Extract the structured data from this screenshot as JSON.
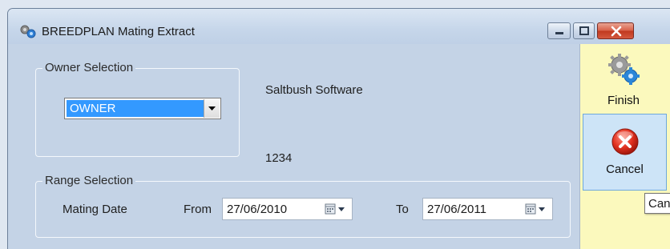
{
  "window": {
    "title": "BREEDPLAN Mating Extract",
    "icon": "gears-icon"
  },
  "owner_selection": {
    "legend": "Owner Selection",
    "owner_dropdown": {
      "selected": "OWNER"
    }
  },
  "info": {
    "company": "Saltbush Software",
    "code": "1234"
  },
  "range_selection": {
    "legend": "Range Selection",
    "row_label": "Mating Date",
    "from_label": "From",
    "from_date": "27/06/2010",
    "to_label": "To",
    "to_date": "27/06/2011"
  },
  "side_panel": {
    "finish_label": "Finish",
    "cancel_label": "Cancel",
    "background": "#fbf9bd"
  },
  "tooltip": {
    "text": "Cancel"
  },
  "colors": {
    "selection": "#3399ff",
    "window_bg": "#c4d3e6",
    "close_button": "#c7402a"
  }
}
